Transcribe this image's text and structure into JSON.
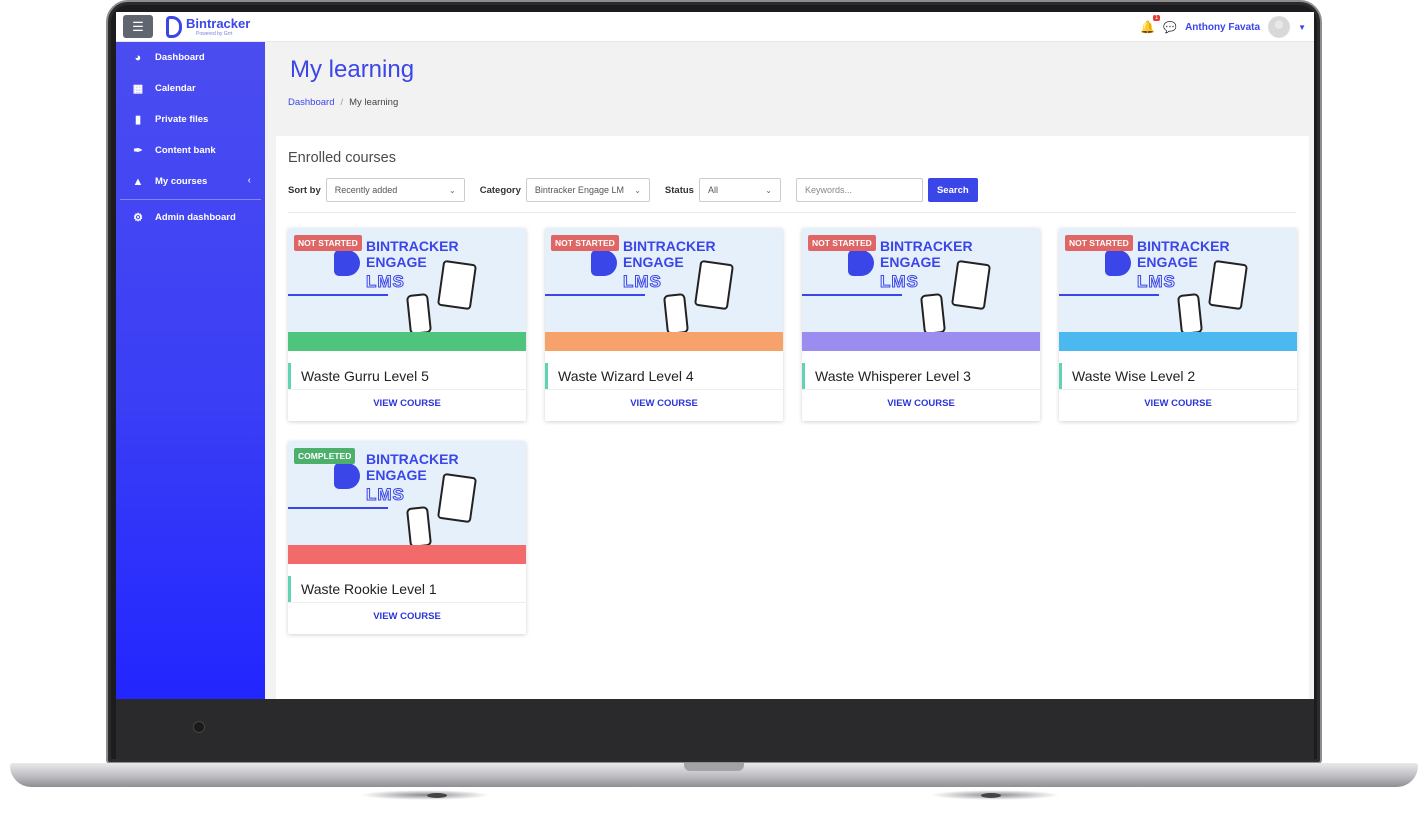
{
  "app": {
    "brand_name": "Bintracker",
    "brand_sub": "Powered by Grrt"
  },
  "topbar": {
    "notification_count": "1",
    "user_name": "Anthony Favata"
  },
  "sidebar": {
    "items": [
      {
        "label": "Dashboard",
        "icon": "dashboard-icon"
      },
      {
        "label": "Calendar",
        "icon": "calendar-icon"
      },
      {
        "label": "Private files",
        "icon": "file-icon"
      },
      {
        "label": "Content bank",
        "icon": "paintbrush-icon"
      },
      {
        "label": "My courses",
        "icon": "graduation-cap-icon"
      },
      {
        "label": "Admin dashboard",
        "icon": "cogs-icon"
      }
    ]
  },
  "page": {
    "title": "My learning",
    "breadcrumb": {
      "link": "Dashboard",
      "sep": "/",
      "current": "My learning"
    }
  },
  "enrolled": {
    "title": "Enrolled courses",
    "filters": {
      "sort_label": "Sort by",
      "sort_value": "Recently added",
      "category_label": "Category",
      "category_value": "Bintracker Engage LM",
      "status_label": "Status",
      "status_value": "All",
      "keywords_placeholder": "Keywords...",
      "search_button": "Search"
    }
  },
  "course_image_text": {
    "line1": "BINTRACKER",
    "line2": "ENGAGE",
    "line3": "LMS"
  },
  "courses": [
    {
      "name": "Waste Gurru Level 5",
      "status": "NOT STARTED",
      "link": "VIEW COURSE",
      "band_color": "#4fc47d"
    },
    {
      "name": "Waste Wizard Level 4",
      "status": "NOT STARTED",
      "link": "VIEW COURSE",
      "band_color": "#f7a26a"
    },
    {
      "name": "Waste Whisperer Level 3",
      "status": "NOT STARTED",
      "link": "VIEW COURSE",
      "band_color": "#9b8df0"
    },
    {
      "name": "Waste Wise Level 2",
      "status": "NOT STARTED",
      "link": "VIEW COURSE",
      "band_color": "#4bb8f0"
    },
    {
      "name": "Waste Rookie Level 1",
      "status": "COMPLETED",
      "link": "VIEW COURSE",
      "band_color": "#f26a6a"
    }
  ],
  "colors": {
    "accent": "#3b46e8",
    "not_started": "#e06666",
    "completed": "#4caf6a",
    "card_accent": "#5fd3b3"
  }
}
